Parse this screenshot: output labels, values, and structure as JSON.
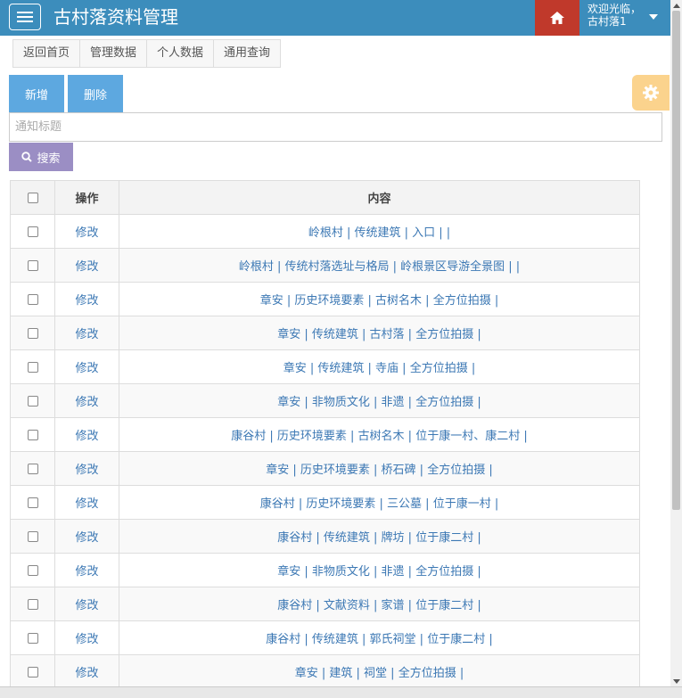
{
  "header": {
    "title": "古村落资料管理",
    "welcome": "欢迎光临，",
    "username": "古村落1",
    "colors": {
      "bar": "#3c8dbc",
      "home": "#c0392b"
    }
  },
  "tabs": [
    {
      "label": "返回首页"
    },
    {
      "label": "管理数据"
    },
    {
      "label": "个人数据"
    },
    {
      "label": "通用查询"
    }
  ],
  "toolbar": {
    "add_label": "新增",
    "delete_label": "删除",
    "search_label": "搜索"
  },
  "search": {
    "placeholder": "通知标题",
    "value": ""
  },
  "table": {
    "headers": {
      "action": "操作",
      "content": "内容"
    },
    "rows": [
      {
        "action": "修改",
        "content": "岭根村 | 传统建筑 | 入口 | |"
      },
      {
        "action": "修改",
        "content": "岭根村 | 传统村落选址与格局 | 岭根景区导游全景图 | |"
      },
      {
        "action": "修改",
        "content": "章安 | 历史环境要素 | 古树名木 | 全方位拍摄 |"
      },
      {
        "action": "修改",
        "content": "章安 | 传统建筑 | 古村落 | 全方位拍摄 |"
      },
      {
        "action": "修改",
        "content": "章安 | 传统建筑 | 寺庙 | 全方位拍摄 |"
      },
      {
        "action": "修改",
        "content": "章安 | 非物质文化 | 非遗 | 全方位拍摄 |"
      },
      {
        "action": "修改",
        "content": "康谷村 | 历史环境要素 | 古树名木 | 位于康一村、康二村 |"
      },
      {
        "action": "修改",
        "content": "章安 | 历史环境要素 | 桥石碑 | 全方位拍摄 |"
      },
      {
        "action": "修改",
        "content": "康谷村 | 历史环境要素 | 三公墓 | 位于康一村 |"
      },
      {
        "action": "修改",
        "content": "康谷村 | 传统建筑 | 牌坊 | 位于康二村 |"
      },
      {
        "action": "修改",
        "content": "章安 | 非物质文化 | 非遗 | 全方位拍摄 |"
      },
      {
        "action": "修改",
        "content": "康谷村 | 文献资料 | 家谱 | 位于康二村 |"
      },
      {
        "action": "修改",
        "content": "康谷村 | 传统建筑 | 郭氏祠堂 | 位于康二村 |"
      },
      {
        "action": "修改",
        "content": "章安 | 建筑 | 祠堂 | 全方位拍摄 |"
      }
    ]
  }
}
